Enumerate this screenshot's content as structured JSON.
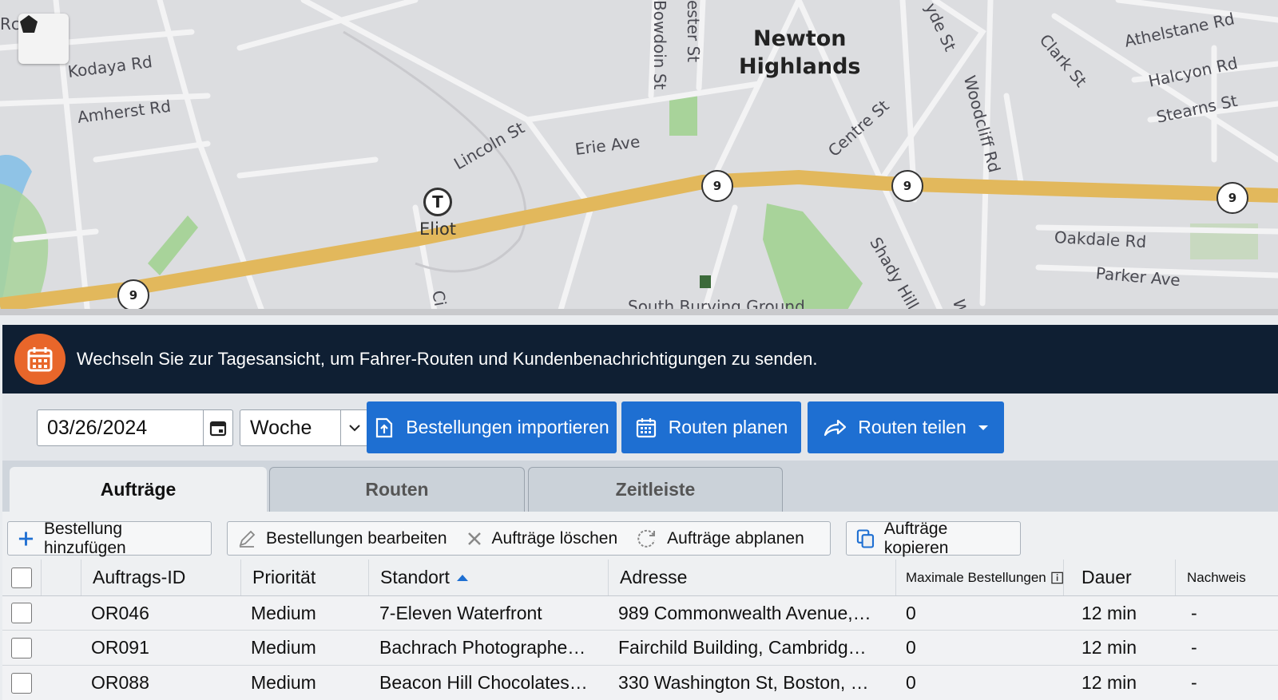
{
  "map": {
    "district_label_line1": "Newton",
    "district_label_line2": "Highlands",
    "transit_glyph": "T",
    "transit_station": "Eliot",
    "route_shield_number": "9",
    "streets": {
      "rd_partial": "Rc",
      "kodaya": "Kodaya Rd",
      "amherst": "Amherst Rd",
      "lincoln": "Lincoln St",
      "erie": "Erie Ave",
      "bowdoin": "Bowdoin St",
      "chester_partial": "ester St",
      "hyde_partial": "yde St",
      "clark": "Clark St",
      "athelstane": "Athelstane Rd",
      "halcyon": "Halcyon Rd",
      "stearns": "Stearns St",
      "centre": "Centre St",
      "woodcliff": "Woodcliff Rd",
      "oakdale": "Oakdale Rd",
      "parker": "Parker Ave",
      "shady_hill": "Shady Hill R",
      "south_burying": "South Burying Ground",
      "ci_partial": "Ci",
      "w_partial": "W"
    },
    "control_icon": "pentagon-icon",
    "colors": {
      "highway": "#e2b85c",
      "park": "#a8d39a",
      "water": "#8fc3e6",
      "land": "#dcdde0"
    }
  },
  "banner": {
    "icon": "calendar-icon",
    "text": "Wechseln Sie zur Tagesansicht, um Fahrer-Routen und Kundenbenachrichtigungen zu senden.",
    "bg": "#0f1f33",
    "badge_color": "#e8662a"
  },
  "toolbar": {
    "date_value": "03/26/2024",
    "period_value": "Woche",
    "import_label": "Bestellungen importieren",
    "plan_label": "Routen planen",
    "share_label": "Routen teilen",
    "accent": "#1e6fd2"
  },
  "tabs": [
    {
      "label": "Aufträge",
      "active": true
    },
    {
      "label": "Routen",
      "active": false
    },
    {
      "label": "Zeitleiste",
      "active": false
    }
  ],
  "actions": {
    "add": "Bestellung hinzufügen",
    "edit": "Bestellungen bearbeiten",
    "delete": "Aufträge löschen",
    "unplan": "Aufträge abplanen",
    "copy": "Aufträge kopieren"
  },
  "table": {
    "columns": {
      "id": "Auftrags-ID",
      "priority": "Priorität",
      "location": "Standort",
      "address": "Adresse",
      "max_orders": "Maximale Bestellungen",
      "duration": "Dauer",
      "proof": "Nachweis"
    },
    "sort_column": "Standort",
    "rows": [
      {
        "id": "OR046",
        "priority": "Medium",
        "location": "7-Eleven Waterfront",
        "address": "989 Commonwealth Avenue,…",
        "max_orders": "0",
        "duration": "12 min",
        "proof": "-"
      },
      {
        "id": "OR091",
        "priority": "Medium",
        "location": "Bachrach Photographe…",
        "address": "Fairchild Building, Cambridg…",
        "max_orders": "0",
        "duration": "12 min",
        "proof": "-"
      },
      {
        "id": "OR088",
        "priority": "Medium",
        "location": "Beacon Hill Chocolates…",
        "address": "330 Washington St, Boston, …",
        "max_orders": "0",
        "duration": "12 min",
        "proof": "-"
      }
    ]
  }
}
